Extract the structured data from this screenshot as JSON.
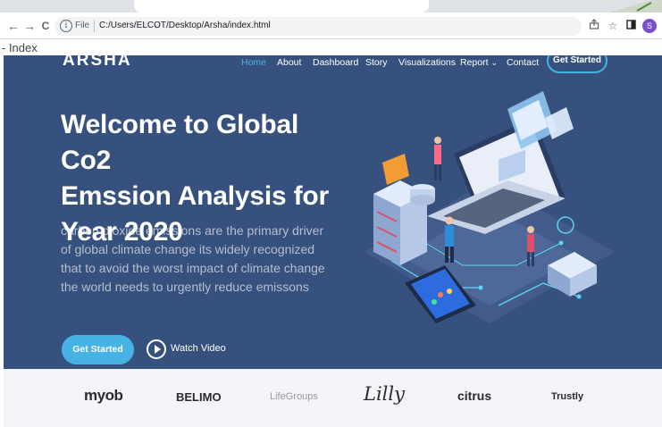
{
  "browser": {
    "nav_back": "←",
    "nav_forward": "→",
    "nav_reload": "C",
    "url_scheme": "File",
    "url": "C:/Users/ELCOT/Desktop/Arsha/index.html",
    "profile_initial": "S",
    "page_title": "- Index",
    "icons": [
      "arrow-left-icon",
      "arrow-right-icon",
      "reload-icon",
      "info-icon",
      "share-icon",
      "star-icon",
      "sidebar-icon",
      "profile-avatar"
    ]
  },
  "site": {
    "logo": "ARSHA",
    "nav": [
      {
        "label": "Home",
        "active": true
      },
      {
        "label": "About"
      },
      {
        "label": "Dashboard"
      },
      {
        "label": "Story"
      },
      {
        "label": "Visualizations"
      },
      {
        "label": "Report"
      },
      {
        "label": "Contact"
      }
    ],
    "report_chevron": "⌄",
    "nav_cta": "Get Started"
  },
  "hero": {
    "headline_line1": "Welcome to Global Co2",
    "headline_line2": "Emssion Analysis for",
    "headline_line3": "Year 2020",
    "subtext": "carbon dioxide emissions are the primary driver of global climate change its widely recognized that to avoid the worst impact of climate change the world needs to urgently reduce emissons",
    "cta": "Get Started",
    "watch": "Watch Video",
    "bg_color": "#37517e",
    "accent_color": "#47b2e4"
  },
  "clients": [
    "myob",
    "BELIMO",
    "LifeGroups",
    "Lilly",
    "citrus",
    "Trustly"
  ]
}
